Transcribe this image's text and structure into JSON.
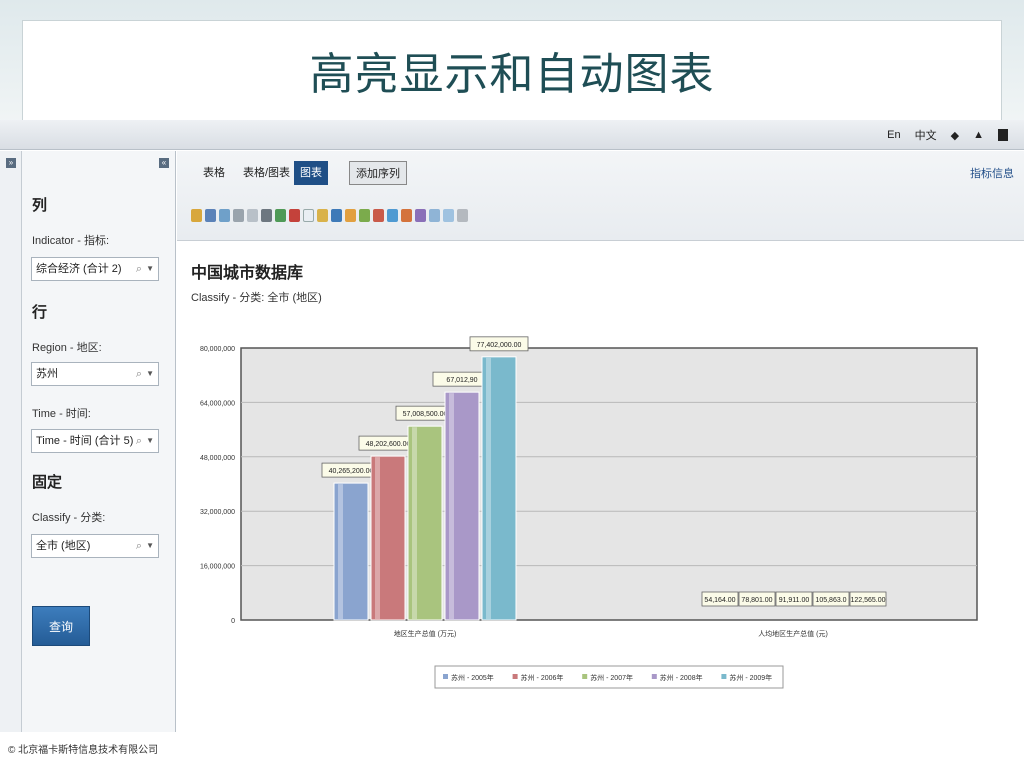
{
  "slide": {
    "title": "高亮显示和自动图表",
    "footer": "© 北京福卡斯特信息技术有限公司"
  },
  "topbar": {
    "lang_en": "En",
    "lang_cn": "中文"
  },
  "sidebar": {
    "col_header": "列",
    "indicator_label": "Indicator - 指标:",
    "indicator_value": "综合经济 (合计 2)",
    "row_header": "行",
    "region_label": "Region - 地区:",
    "region_value": "苏州",
    "time_label": "Time - 时间:",
    "time_value": "Time - 时间 (合计 5)",
    "fixed_header": "固定",
    "classify_label": "Classify - 分类:",
    "classify_value": "全市 (地区)",
    "query_button": "查询"
  },
  "main": {
    "tabs": [
      "表格",
      "表格/图表",
      "图表"
    ],
    "add_series": "添加序列",
    "indicator_info": "指标信息",
    "db_title": "中国城市数据库",
    "db_subtitle": "Classify - 分类: 全市 (地区)"
  },
  "chart_data": {
    "type": "bar",
    "categories": [
      "地区生产总值 (万元)",
      "人均地区生产总值 (元)"
    ],
    "series": [
      {
        "name": "苏州 - 2005年",
        "values": [
          40265200,
          54164
        ],
        "labels": [
          "40,265,200.00",
          "54,164.00"
        ],
        "color": "#8aa4cf"
      },
      {
        "name": "苏州 - 2006年",
        "values": [
          48202600,
          78801
        ],
        "labels": [
          "48,202,600.00",
          "78,801.00"
        ],
        "color": "#c9797b"
      },
      {
        "name": "苏州 - 2007年",
        "values": [
          57008500,
          91911
        ],
        "labels": [
          "57,008,500.00",
          "91,911.00"
        ],
        "color": "#a9c47e"
      },
      {
        "name": "苏州 - 2008年",
        "values": [
          67012900,
          105863
        ],
        "labels": [
          "67,012,90",
          "105,863.0"
        ],
        "color": "#a998c8"
      },
      {
        "name": "苏州 - 2009年",
        "values": [
          77402000,
          122565
        ],
        "labels": [
          "77,402,000.00",
          "122,565.00"
        ],
        "color": "#7ab9cc"
      }
    ],
    "yticks": [
      "80,000,000",
      "64,000,000",
      "48,000,000",
      "32,000,000",
      "16,000,000",
      "0"
    ],
    "ylim": [
      0,
      80000000
    ],
    "grid": true,
    "legend": "bottom"
  }
}
